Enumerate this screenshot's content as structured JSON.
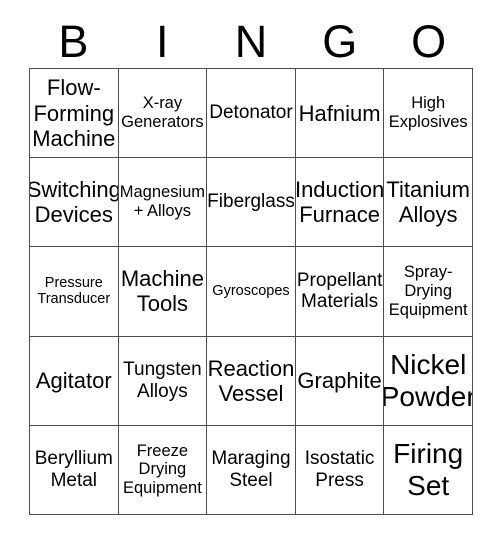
{
  "card": {
    "title_letters": [
      "B",
      "I",
      "N",
      "G",
      "O"
    ],
    "colors": {
      "background": "#ffffff",
      "text": "#000000",
      "grid_line": "#4d4d4d"
    },
    "rows": [
      [
        {
          "label": "Flow-\nForming\nMachine",
          "size": "l"
        },
        {
          "label": "X-ray\nGenerators",
          "size": "s"
        },
        {
          "label": "Detonator",
          "size": "m"
        },
        {
          "label": "Hafnium",
          "size": "l"
        },
        {
          "label": "High\nExplosives",
          "size": "s"
        }
      ],
      [
        {
          "label": "Switching\nDevices",
          "size": "l"
        },
        {
          "label": "Magnesium\n+ Alloys",
          "size": "s"
        },
        {
          "label": "Fiberglass",
          "size": "m"
        },
        {
          "label": "Induction\nFurnace",
          "size": "l"
        },
        {
          "label": "Titanium\nAlloys",
          "size": "l"
        }
      ],
      [
        {
          "label": "Pressure\nTransducer",
          "size": "xs"
        },
        {
          "label": "Machine\nTools",
          "size": "l"
        },
        {
          "label": "Gyroscopes",
          "size": "xs"
        },
        {
          "label": "Propellant\nMaterials",
          "size": "m"
        },
        {
          "label": "Spray-\nDrying\nEquipment",
          "size": "s"
        }
      ],
      [
        {
          "label": "Agitator",
          "size": "l"
        },
        {
          "label": "Tungsten\nAlloys",
          "size": "m"
        },
        {
          "label": "Reaction\nVessel",
          "size": "l"
        },
        {
          "label": "Graphite",
          "size": "l"
        },
        {
          "label": "Nickel\nPowder",
          "size": "xl"
        }
      ],
      [
        {
          "label": "Beryllium\nMetal",
          "size": "m"
        },
        {
          "label": "Freeze\nDrying\nEquipment",
          "size": "s"
        },
        {
          "label": "Maraging\nSteel",
          "size": "m"
        },
        {
          "label": "Isostatic\nPress",
          "size": "m"
        },
        {
          "label": "Firing\nSet",
          "size": "xl"
        }
      ]
    ]
  }
}
